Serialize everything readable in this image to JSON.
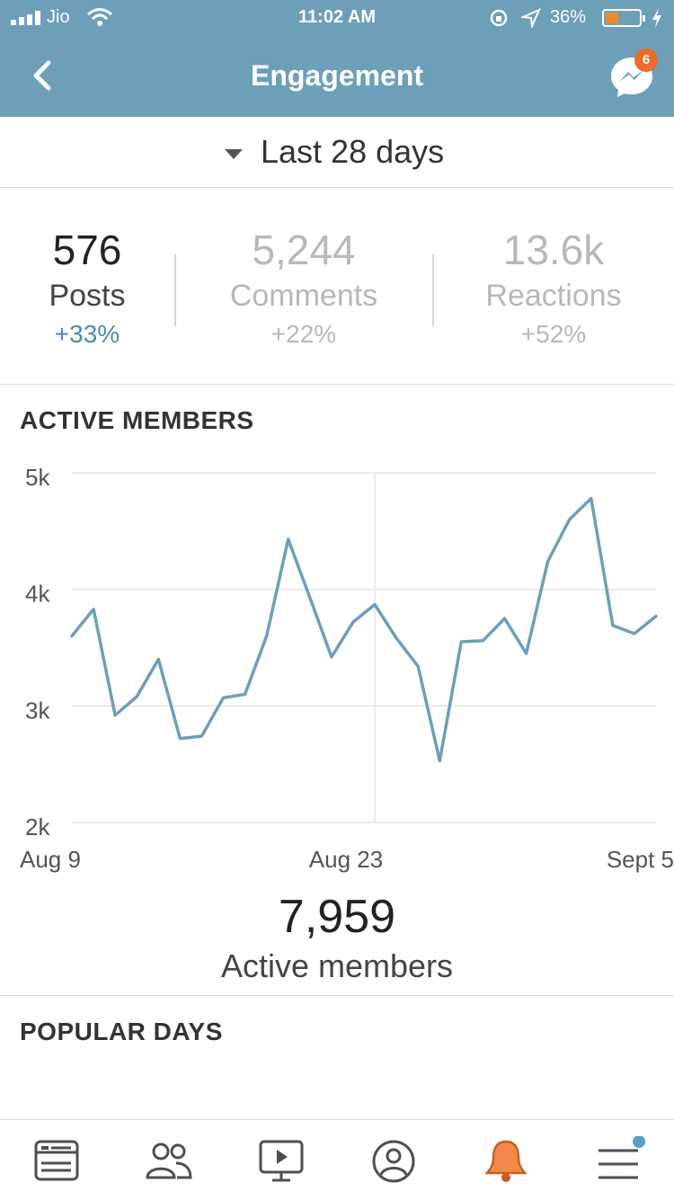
{
  "status_bar": {
    "carrier": "Jio",
    "time": "11:02 AM",
    "battery_percent": "36%",
    "icons": [
      "signal-icon",
      "wifi-icon",
      "rotation-lock-icon",
      "location-icon",
      "battery-icon",
      "charging-icon"
    ]
  },
  "header": {
    "title": "Engagement",
    "back_icon": "chevron-left-icon",
    "messenger_icon": "messenger-icon",
    "messenger_badge": "6",
    "background_color": "#6d9fb9"
  },
  "date_range": {
    "label": "Last 28 days",
    "caret_icon": "caret-down-icon"
  },
  "stats": [
    {
      "value": "576",
      "label": "Posts",
      "change": "+33%",
      "selected": true
    },
    {
      "value": "5,244",
      "label": "Comments",
      "change": "+22%",
      "selected": false
    },
    {
      "value": "13.6k",
      "label": "Reactions",
      "change": "+52%",
      "selected": false
    }
  ],
  "active_members": {
    "section_title": "ACTIVE MEMBERS",
    "total_value": "7,959",
    "total_label": "Active members"
  },
  "chart_data": {
    "type": "line",
    "title": "",
    "xlabel": "",
    "ylabel": "",
    "x_tick_labels": [
      "Aug 9",
      "Aug 23",
      "Sept 5"
    ],
    "y_tick_labels": [
      "5k",
      "4k",
      "3k",
      "2k"
    ],
    "y_ticks": [
      5000,
      4000,
      3000,
      2000
    ],
    "ylim": [
      2000,
      5000
    ],
    "grid": true,
    "line_color": "#6d9fb9",
    "series": [
      {
        "values": [
          3600,
          3830,
          2920,
          3080,
          3400,
          2720,
          2740,
          3070,
          3100,
          3600,
          4430,
          3930,
          3420,
          3720,
          3870,
          3580,
          3340,
          2530,
          3550,
          3560,
          3750,
          3450,
          4240,
          4600,
          4780,
          3690,
          3620,
          3770
        ]
      }
    ]
  },
  "popular_days": {
    "section_title": "POPULAR DAYS"
  },
  "tab_bar": {
    "tabs": [
      {
        "icon": "news-feed-icon"
      },
      {
        "icon": "groups-icon"
      },
      {
        "icon": "watch-icon"
      },
      {
        "icon": "profile-icon"
      },
      {
        "icon": "notifications-bell-icon",
        "active": true
      },
      {
        "icon": "menu-icon",
        "has_dot": true
      }
    ]
  }
}
